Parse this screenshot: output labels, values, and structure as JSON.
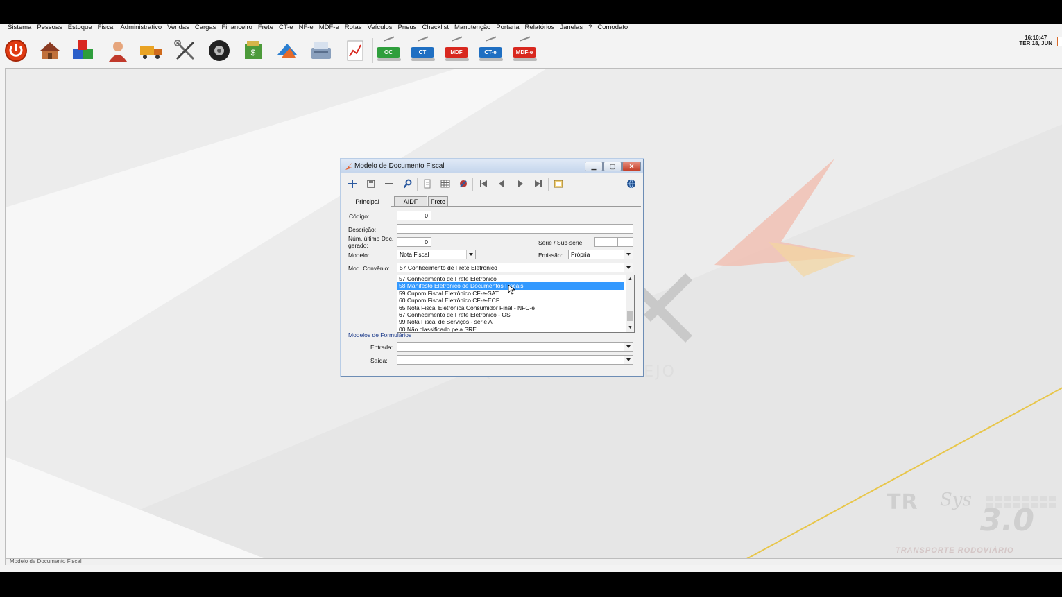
{
  "menu": [
    "Sistema",
    "Pessoas",
    "Estoque",
    "Fiscal",
    "Administrativo",
    "Vendas",
    "Cargas",
    "Financeiro",
    "Frete",
    "CT-e",
    "NF-e",
    "MDF-e",
    "Rotas",
    "Veículos",
    "Pneus",
    "Checklist",
    "Manutenção",
    "Portaria",
    "Relatórios",
    "Janelas",
    "?",
    "Comodato"
  ],
  "toolbar": {
    "labeled": [
      {
        "label": "OC",
        "color": "#2e9e3c"
      },
      {
        "label": "CT",
        "color": "#1f6fc2"
      },
      {
        "label": "MDF",
        "color": "#d8281f"
      },
      {
        "label": "CT-e",
        "color": "#1f6fc2"
      },
      {
        "label": "MDF-e",
        "color": "#d8281f"
      }
    ]
  },
  "clock": {
    "time": "16:10:47",
    "date": "TER 18, JUN"
  },
  "brand": {
    "tagline": "SOFTWARE QUE MOVE O VAREJO",
    "tr": "TR",
    "sys": "Sys",
    "version": "3.0",
    "subtitle": "TRANSPORTE RODOVIÁRIO"
  },
  "statusbar": {
    "window": "Modelo de Documento Fiscal"
  },
  "dialog": {
    "title": "Modelo de Documento Fiscal",
    "tabs": [
      "Principal",
      "AIDF",
      "Frete"
    ],
    "form": {
      "codigo_label": "Código:",
      "codigo_value": "0",
      "descricao_label": "Descrição:",
      "descricao_value": "",
      "num_label_1": "Núm. último Doc.",
      "num_label_2": "gerado:",
      "num_value": "0",
      "serie_label": "Série / Sub-série:",
      "serie_value": "",
      "subserie_value": "",
      "modelo_label": "Modelo:",
      "modelo_value": "Nota Fiscal",
      "emissao_label": "Emissão:",
      "emissao_value": "Própria",
      "convenio_label": "Mod. Convênio:",
      "convenio_value": "57 Conhecimento de Frete Eletrônico",
      "convenio_options": [
        "57 Conhecimento de Frete Eletrônico",
        "58 Manifesto Eletrônico de Documentos Fiscais",
        "59 Cupom Fiscal Eletrônico CF-e-SAT",
        "60 Cupom Fiscal Eletrônico CF-e-ECF",
        "65 Nota Fiscal Eletrônica Consumidor Final - NFC-e",
        "67 Conhecimento de Frete Eletrônico - OS",
        "99 Nota Fiscal de Serviços - série A",
        "00 Não classificado pela SRE"
      ],
      "convenio_highlighted": "58 Manifesto Eletrônico de Documentos Fiscais",
      "modelos_formularios": "Modelos de Formulários",
      "entrada_label": "Entrada:",
      "entrada_value": "",
      "saida_label": "Saída:",
      "saida_value": ""
    }
  }
}
